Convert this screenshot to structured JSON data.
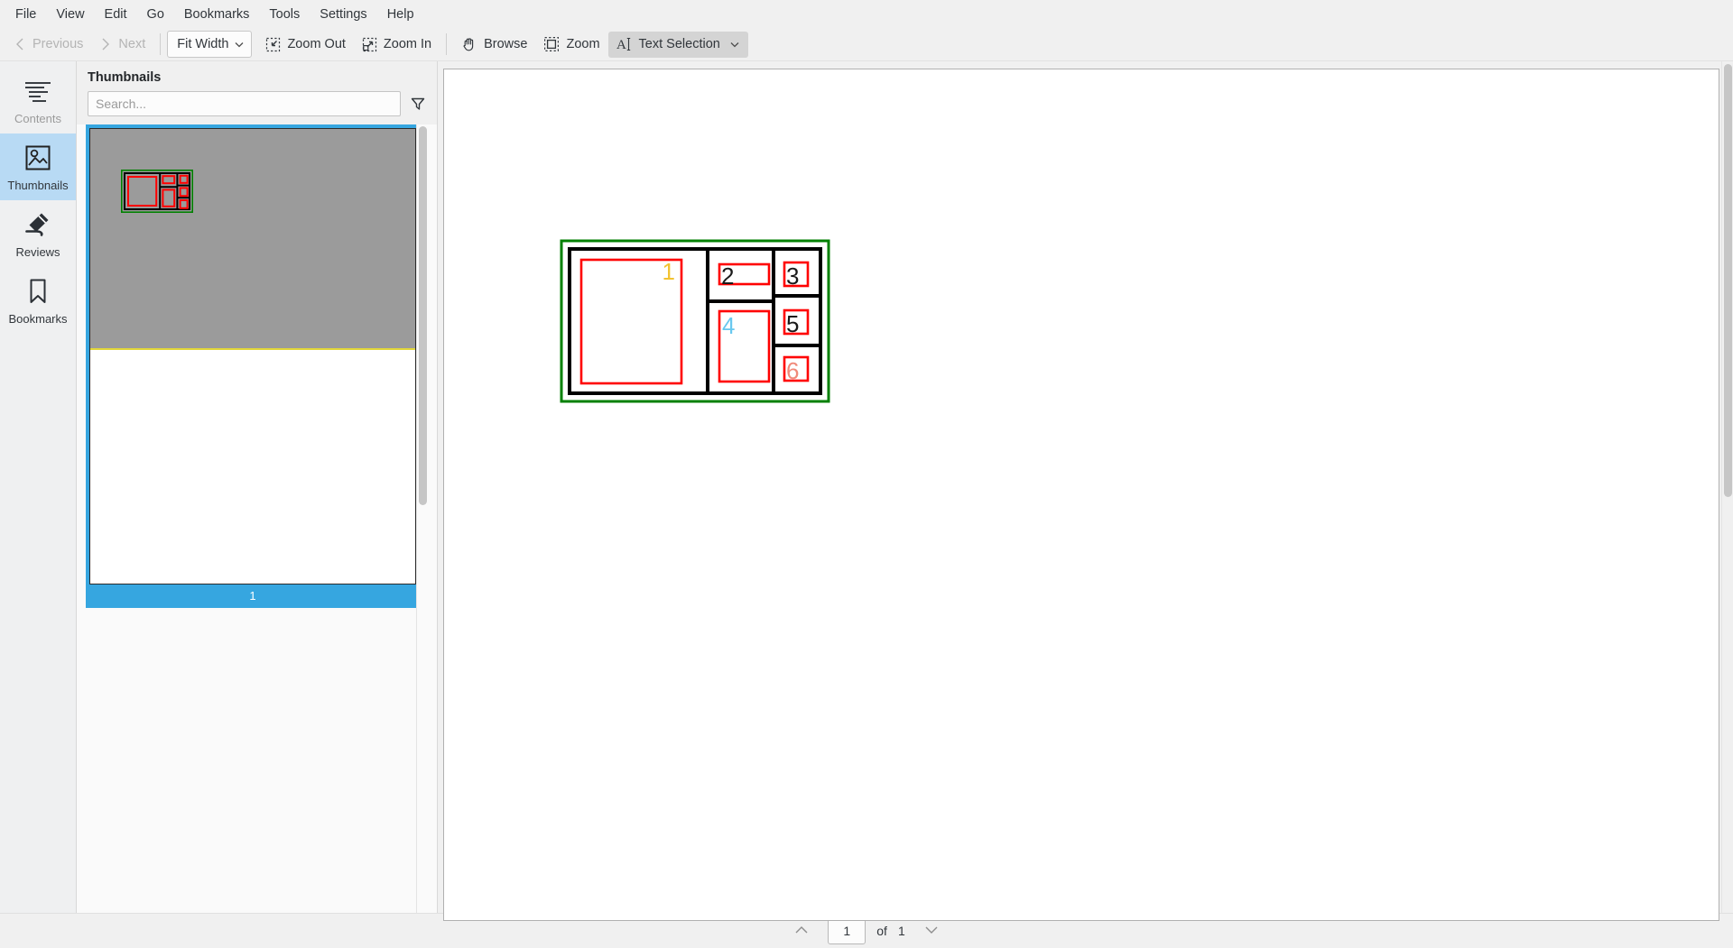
{
  "menubar": {
    "items": [
      {
        "label": "File"
      },
      {
        "label": "View"
      },
      {
        "label": "Edit"
      },
      {
        "label": "Go"
      },
      {
        "label": "Bookmarks"
      },
      {
        "label": "Tools"
      },
      {
        "label": "Settings"
      },
      {
        "label": "Help"
      }
    ]
  },
  "toolbar": {
    "previous_label": "Previous",
    "next_label": "Next",
    "zoom_select_value": "Fit Width",
    "zoom_out_label": "Zoom Out",
    "zoom_in_label": "Zoom In",
    "browse_label": "Browse",
    "zoom_label": "Zoom",
    "text_selection_label": "Text Selection",
    "icons": {
      "previous": "chevron-left-icon",
      "next": "chevron-right-icon",
      "zoom_out": "zoom-out-icon",
      "zoom_in": "zoom-in-icon",
      "browse": "hand-icon",
      "zoom": "marquee-zoom-icon",
      "text_selection": "text-cursor-icon",
      "dropdown": "chevron-down-icon"
    }
  },
  "sidebar": {
    "items": [
      {
        "label": "Contents",
        "icon": "contents-icon",
        "selected": false,
        "muted": true
      },
      {
        "label": "Thumbnails",
        "icon": "thumbnails-icon",
        "selected": true,
        "muted": false
      },
      {
        "label": "Reviews",
        "icon": "highlighter-icon",
        "selected": false,
        "muted": false
      },
      {
        "label": "Bookmarks",
        "icon": "bookmark-icon",
        "selected": false,
        "muted": false
      }
    ]
  },
  "thumbnails_panel": {
    "title": "Thumbnails",
    "search_placeholder": "Search...",
    "search_value": "",
    "filter_icon": "filter-funnel-icon",
    "pages": [
      {
        "number": "1",
        "selected": true
      }
    ]
  },
  "statusbar": {
    "current_page": "1",
    "of_label": "of",
    "total_pages": "1",
    "up_icon": "chevron-up-icon",
    "down_icon": "chevron-down-icon"
  },
  "document": {
    "page_background": "#ffffff",
    "diagram": {
      "outer_border_color": "#008000",
      "grid_border_color": "#000000",
      "box_border_color": "#ff0000",
      "cells": [
        {
          "id": "cell-1",
          "label": "1",
          "label_color": "#f2c230"
        },
        {
          "id": "cell-2",
          "label": "2",
          "label_color": "#1a1a1a"
        },
        {
          "id": "cell-3",
          "label": "3",
          "label_color": "#1a1a1a"
        },
        {
          "id": "cell-4",
          "label": "4",
          "label_color": "#68c8ef"
        },
        {
          "id": "cell-5",
          "label": "5",
          "label_color": "#1a1a1a"
        },
        {
          "id": "cell-6",
          "label": "6",
          "label_color": "#f08a7a"
        }
      ]
    }
  }
}
